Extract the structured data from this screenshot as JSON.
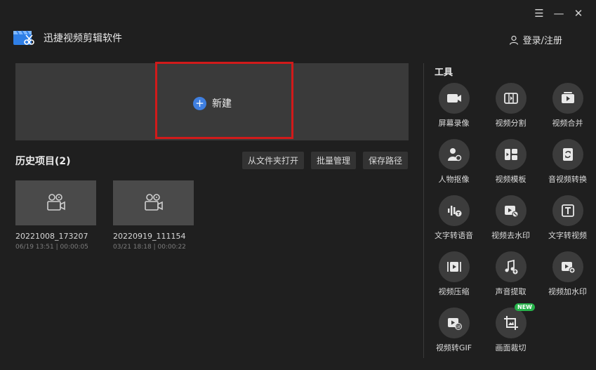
{
  "window": {
    "menu_icon": "menu-icon",
    "minimize_icon": "minimize-icon",
    "close_icon": "close-icon"
  },
  "app": {
    "title": "迅捷视频剪辑软件",
    "logo_icon": "clapperboard-scissors-logo"
  },
  "header": {
    "login_label": "登录/注册",
    "user_icon": "user-icon"
  },
  "new_project": {
    "label": "新建",
    "icon": "plus-icon",
    "highlight_color": "#d11a1a"
  },
  "history": {
    "title": "历史项目(2)",
    "actions": [
      "从文件夹打开",
      "批量管理",
      "保存路径"
    ],
    "projects": [
      {
        "name": "20221008_173207",
        "meta": "06/19 13:51 | 00:00:05"
      },
      {
        "name": "20220919_111154",
        "meta": "03/21 18:18 | 00:00:22"
      }
    ]
  },
  "tools": {
    "title": "工具",
    "items": [
      {
        "label": "屏幕录像",
        "icon": "screen-record-icon"
      },
      {
        "label": "视频分割",
        "icon": "video-split-icon"
      },
      {
        "label": "视频合并",
        "icon": "video-merge-icon"
      },
      {
        "label": "人物抠像",
        "icon": "person-cutout-icon"
      },
      {
        "label": "视频模板",
        "icon": "video-template-icon"
      },
      {
        "label": "音视频转换",
        "icon": "av-convert-icon"
      },
      {
        "label": "文字转语音",
        "icon": "text-to-speech-icon"
      },
      {
        "label": "视频去水印",
        "icon": "remove-watermark-icon"
      },
      {
        "label": "文字转视频",
        "icon": "text-to-video-icon"
      },
      {
        "label": "视频压缩",
        "icon": "video-compress-icon"
      },
      {
        "label": "声音提取",
        "icon": "audio-extract-icon"
      },
      {
        "label": "视频加水印",
        "icon": "add-watermark-icon"
      },
      {
        "label": "视频转GIF",
        "icon": "video-to-gif-icon"
      },
      {
        "label": "画面裁切",
        "icon": "crop-icon",
        "badge": "NEW"
      }
    ]
  },
  "colors": {
    "background": "#1f1f1f",
    "accent_blue": "#3f7fe0",
    "badge_green": "#26b24a"
  }
}
